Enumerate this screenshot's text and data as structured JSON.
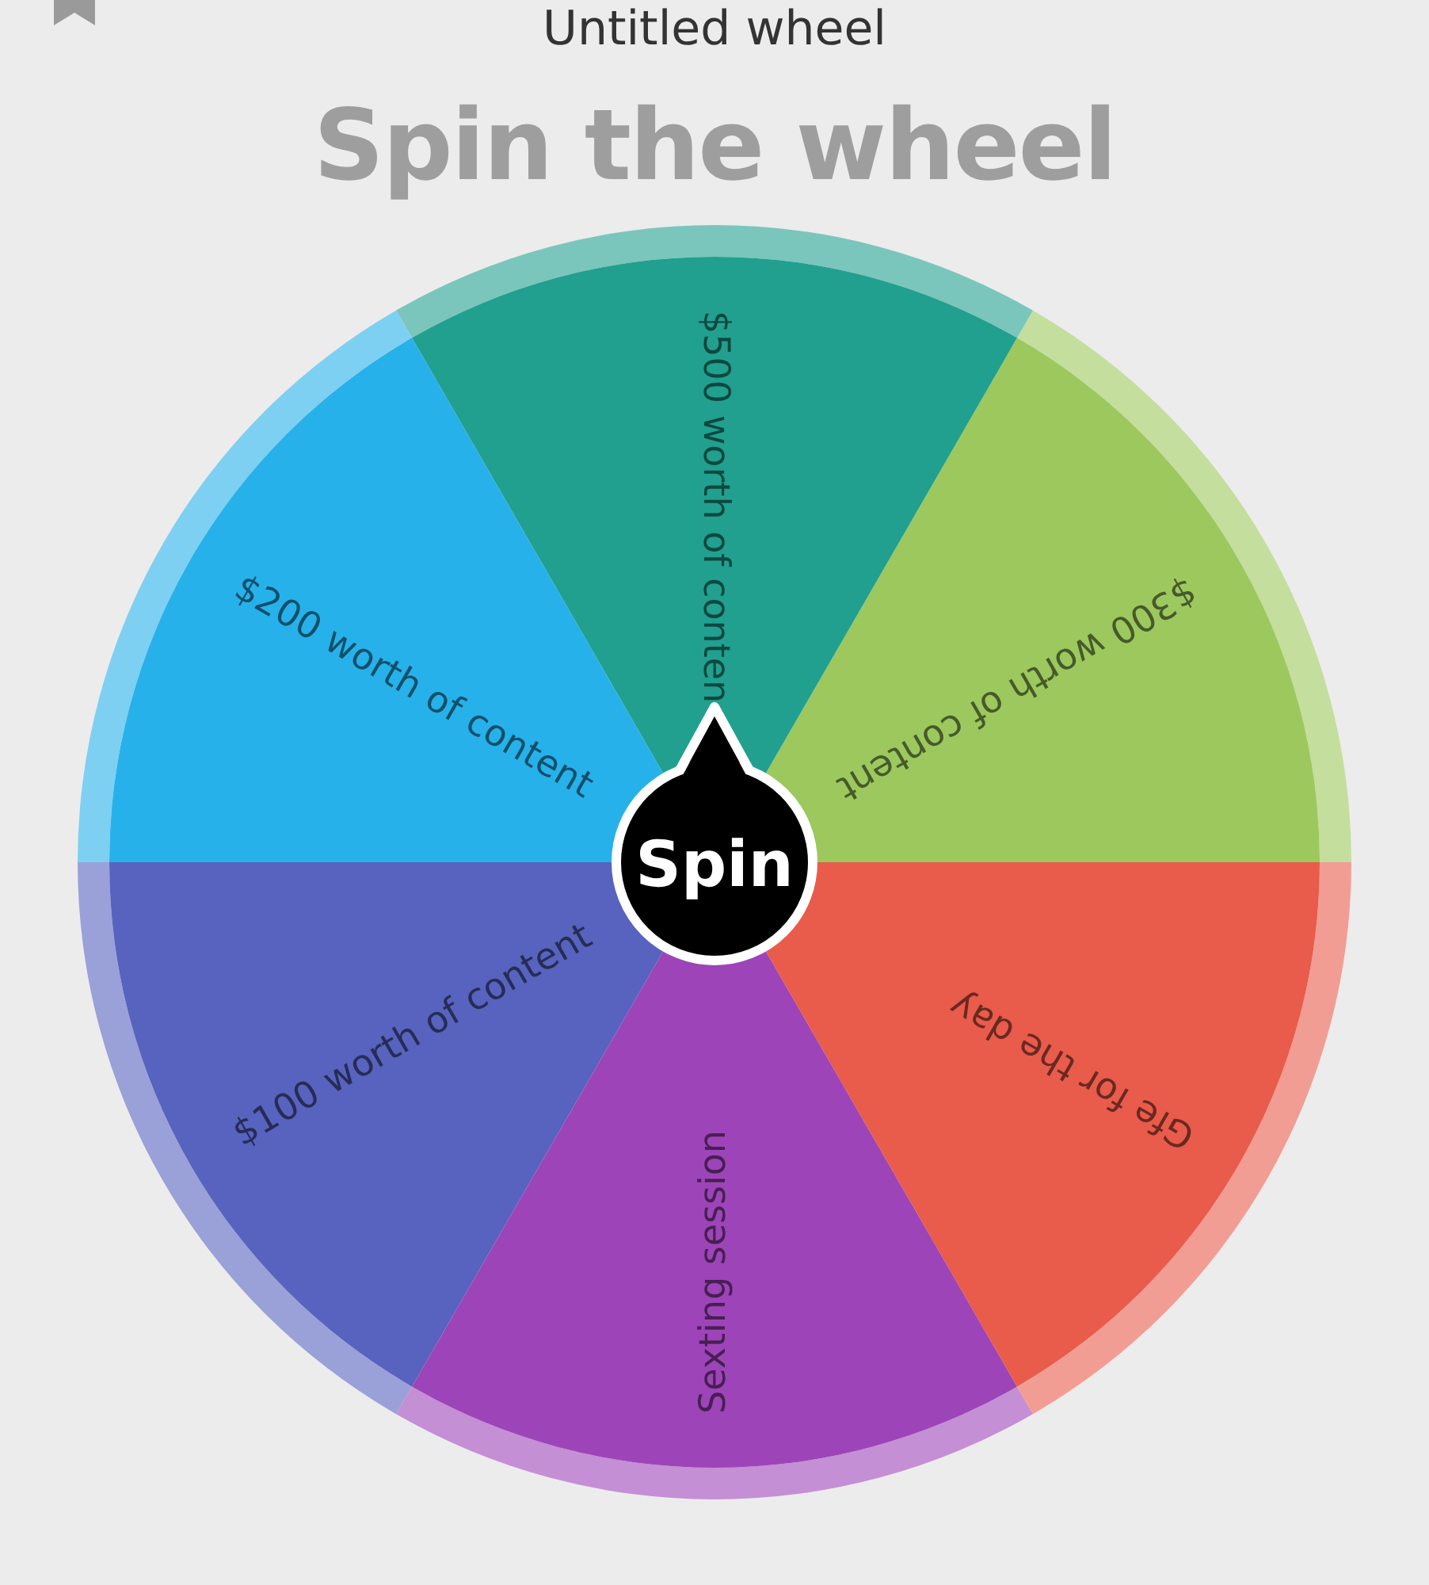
{
  "window": {
    "title": "Untitled wheel"
  },
  "heading": "Spin the wheel",
  "wheel": {
    "segments": [
      {
        "label": "$300 worth of content",
        "color": "#9cc85e"
      },
      {
        "label": "$500 worth of conten",
        "color": "#21a08f"
      },
      {
        "label": "$200 worth of content",
        "color": "#27b1ea"
      },
      {
        "label": "$100 worth of content",
        "color": "#5763be"
      },
      {
        "label": "Sexting session",
        "color": "#9d45b8"
      },
      {
        "label": "Gfe for the day",
        "color": "#e95b4b"
      }
    ],
    "spin_button": "Spin"
  }
}
